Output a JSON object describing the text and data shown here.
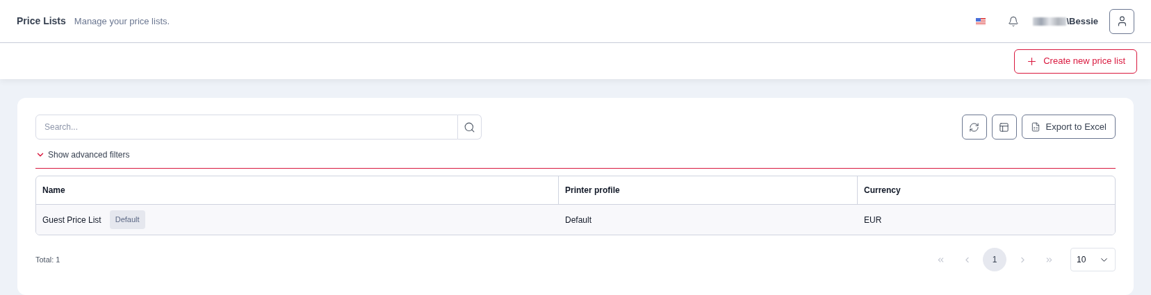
{
  "header": {
    "title": "Price Lists",
    "subtitle": "Manage your price lists.",
    "user": "\\Bessie"
  },
  "toolbar": {
    "create_button": "Create new price list"
  },
  "search": {
    "placeholder": "Search..."
  },
  "actions": {
    "export_button": "Export to Excel"
  },
  "filters": {
    "label": "Show advanced filters",
    "expanded": false
  },
  "table": {
    "columns": [
      "Name",
      "Printer profile",
      "Currency"
    ],
    "rows": [
      {
        "name": "Guest Price List",
        "badge": "Default",
        "printer_profile": "Default",
        "currency": "EUR"
      }
    ]
  },
  "footer": {
    "total": "Total: 1",
    "pages": [
      {
        "label": "1",
        "selected": true
      }
    ],
    "nav": {
      "disabled": true
    },
    "page_size": "10"
  }
}
